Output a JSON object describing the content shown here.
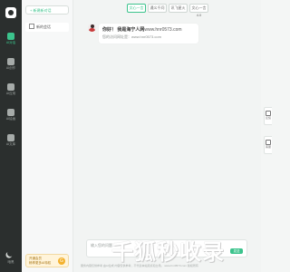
{
  "rail": {
    "items": [
      {
        "label": "AI对话",
        "icon": "chat-icon",
        "active": true
      },
      {
        "label": "AI创作",
        "icon": "pen-icon",
        "active": false
      },
      {
        "label": "AI应用",
        "icon": "bulb-icon",
        "active": false
      },
      {
        "label": "AI绘画",
        "icon": "palette-icon",
        "active": false
      },
      {
        "label": "AI文库",
        "icon": "book-icon",
        "active": false
      }
    ],
    "bottom_label": "暗黑"
  },
  "sidebar": {
    "new_chat_label": "+ 新建新对话",
    "conversations": [
      {
        "label": "新的会话"
      }
    ],
    "promo": {
      "line1": "开通会员",
      "line2": "畅享更多AI特权",
      "badge": "G"
    }
  },
  "model_tabs": [
    {
      "label": "文心一言",
      "active": true
    },
    {
      "label": "通义千问",
      "active": false
    },
    {
      "label": "讯飞星火",
      "active": false
    },
    {
      "label": "文心一言4.0",
      "active": false
    }
  ],
  "message": {
    "greeting": "你好！ 我是海宁人网",
    "site": "www.hnr0573.com",
    "subline": "您的访问网址是：www.hnr0573.com"
  },
  "input": {
    "placeholder": "输入您的问题...",
    "send_label": "发送"
  },
  "disclaimer": "服务内容仅供参考 由AI生成 内容仅供参考，不代表本站观点和立场。 www.hnr0573.com 版权所有",
  "float_buttons": [
    {
      "label": "反馈",
      "icon": "feedback-icon"
    },
    {
      "label": "客服",
      "icon": "service-icon"
    }
  ],
  "watermark": "千狐秒收录",
  "colors": {
    "accent": "#3bc38c",
    "rail": "#2b2f2e"
  }
}
